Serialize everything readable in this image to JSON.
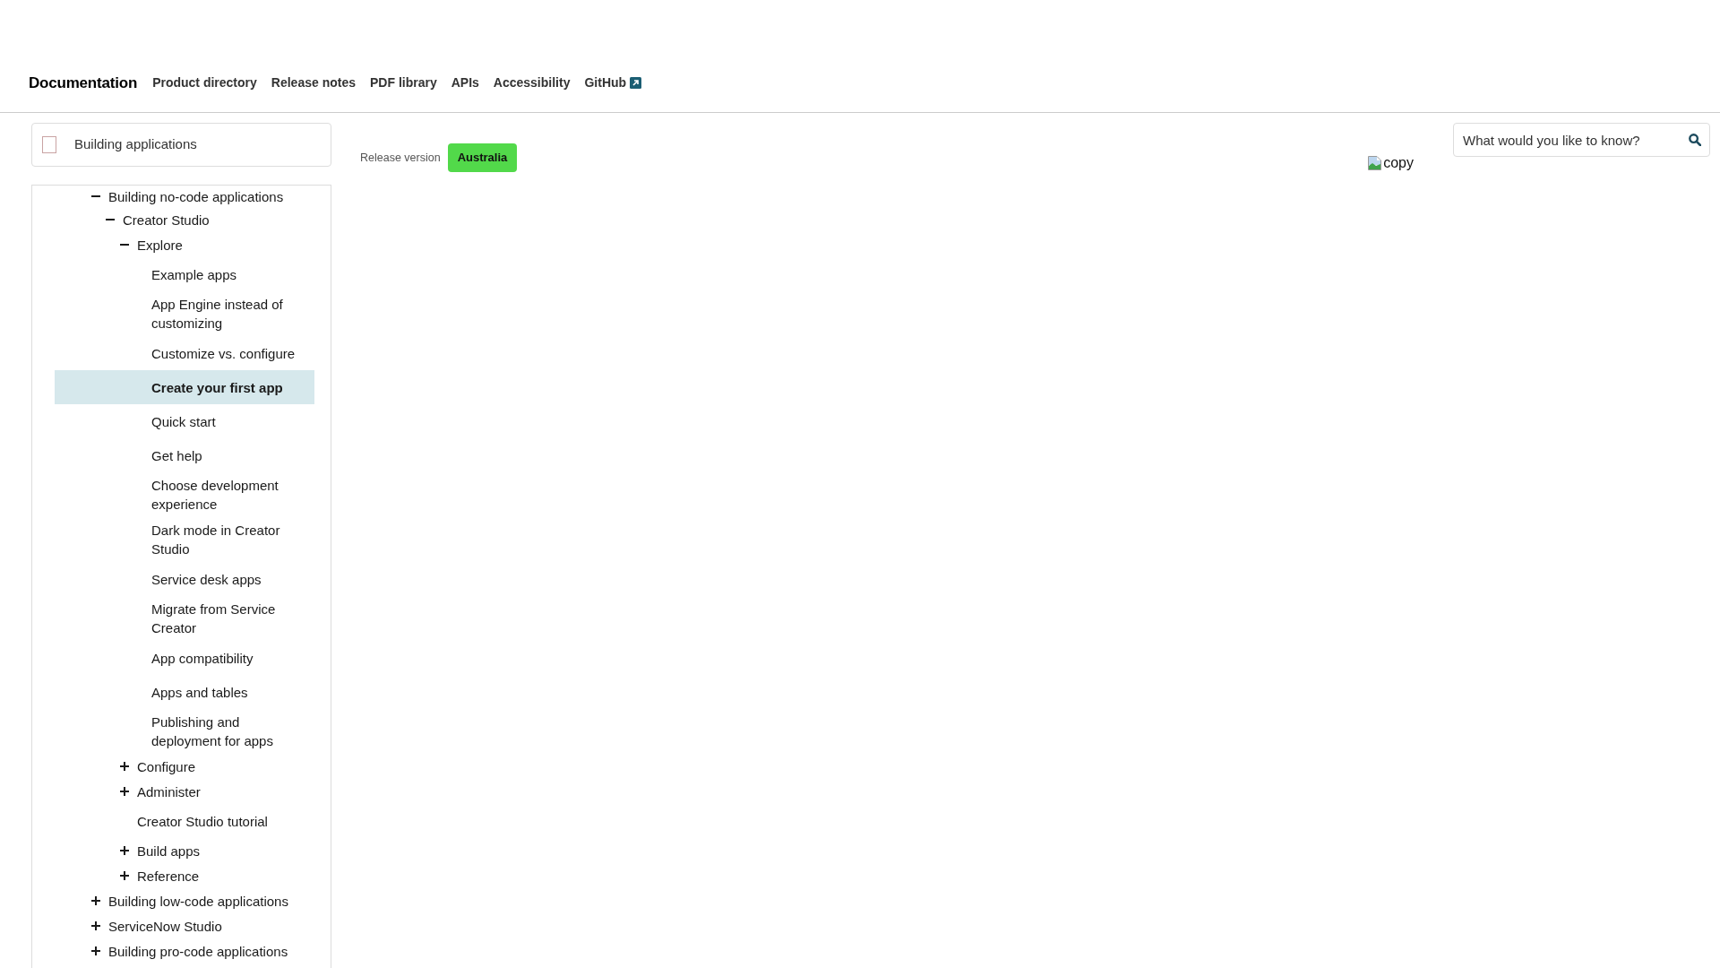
{
  "top_nav": {
    "title": "Documentation",
    "links": [
      {
        "label": "Product directory",
        "external": false
      },
      {
        "label": "Release notes",
        "external": false
      },
      {
        "label": "PDF library",
        "external": false
      },
      {
        "label": "APIs",
        "external": false
      },
      {
        "label": "Accessibility",
        "external": false
      },
      {
        "label": "GitHub",
        "external": true
      }
    ]
  },
  "sidebar": {
    "header": {
      "title": "Building applications"
    },
    "tree": [
      {
        "label": "Building no-code applications",
        "kind": "section",
        "expanded": true,
        "selected": false,
        "children": [
          {
            "label": "Creator Studio",
            "kind": "section",
            "expanded": true,
            "selected": false,
            "children": [
              {
                "label": "Explore",
                "kind": "section",
                "expanded": true,
                "selected": false,
                "children": [
                  {
                    "label": "Example apps",
                    "kind": "page",
                    "selected": false
                  },
                  {
                    "label": "App Engine instead of customizing",
                    "kind": "page",
                    "selected": false
                  },
                  {
                    "label": "Customize vs. configure",
                    "kind": "page",
                    "selected": false
                  },
                  {
                    "label": "Create your first app",
                    "kind": "page",
                    "selected": true
                  },
                  {
                    "label": "Quick start",
                    "kind": "page",
                    "selected": false
                  },
                  {
                    "label": "Get help",
                    "kind": "page",
                    "selected": false
                  },
                  {
                    "label": "Choose development experience",
                    "kind": "page",
                    "selected": false
                  },
                  {
                    "label": "Dark mode in Creator Studio",
                    "kind": "page",
                    "selected": false
                  },
                  {
                    "label": "Service desk apps",
                    "kind": "page",
                    "selected": false
                  },
                  {
                    "label": "Migrate from Service Creator",
                    "kind": "page",
                    "selected": false
                  },
                  {
                    "label": "App compatibility",
                    "kind": "page",
                    "selected": false
                  },
                  {
                    "label": "Apps and tables",
                    "kind": "page",
                    "selected": false
                  },
                  {
                    "label": "Publishing and deployment for apps",
                    "kind": "page",
                    "selected": false
                  }
                ]
              },
              {
                "label": "Configure",
                "kind": "section",
                "expanded": false,
                "selected": false
              },
              {
                "label": "Administer",
                "kind": "section",
                "expanded": false,
                "selected": false
              },
              {
                "label": "Creator Studio tutorial",
                "kind": "page",
                "selected": false
              },
              {
                "label": "Build apps",
                "kind": "section",
                "expanded": false,
                "selected": false
              },
              {
                "label": "Reference",
                "kind": "section",
                "expanded": false,
                "selected": false
              }
            ]
          }
        ]
      },
      {
        "label": "Building low-code applications",
        "kind": "section",
        "expanded": false,
        "selected": false
      },
      {
        "label": "ServiceNow Studio",
        "kind": "section",
        "expanded": false,
        "selected": false
      },
      {
        "label": "Building pro-code applications",
        "kind": "section",
        "expanded": false,
        "selected": false
      }
    ]
  },
  "release": {
    "label": "Release version",
    "version": "Australia"
  },
  "copy_image": {
    "alt_text": "copy"
  },
  "search": {
    "placeholder": "What would you like to know?"
  }
}
